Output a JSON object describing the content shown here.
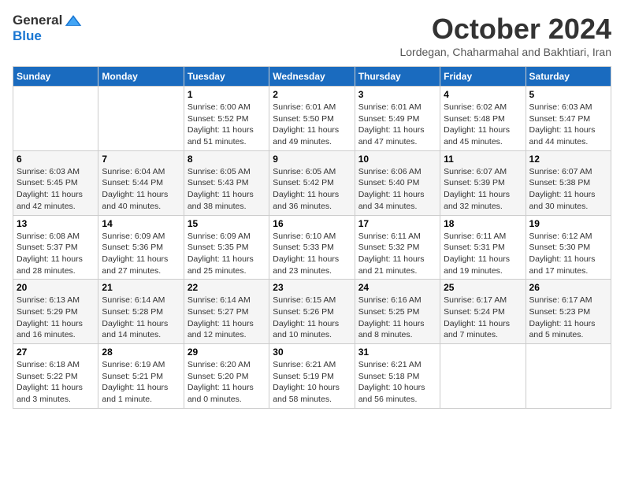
{
  "header": {
    "logo_general": "General",
    "logo_blue": "Blue",
    "month": "October 2024",
    "location": "Lordegan, Chaharmahal and Bakhtiari, Iran"
  },
  "weekdays": [
    "Sunday",
    "Monday",
    "Tuesday",
    "Wednesday",
    "Thursday",
    "Friday",
    "Saturday"
  ],
  "weeks": [
    [
      {
        "day": "",
        "info": ""
      },
      {
        "day": "",
        "info": ""
      },
      {
        "day": "1",
        "info": "Sunrise: 6:00 AM\nSunset: 5:52 PM\nDaylight: 11 hours and 51 minutes."
      },
      {
        "day": "2",
        "info": "Sunrise: 6:01 AM\nSunset: 5:50 PM\nDaylight: 11 hours and 49 minutes."
      },
      {
        "day": "3",
        "info": "Sunrise: 6:01 AM\nSunset: 5:49 PM\nDaylight: 11 hours and 47 minutes."
      },
      {
        "day": "4",
        "info": "Sunrise: 6:02 AM\nSunset: 5:48 PM\nDaylight: 11 hours and 45 minutes."
      },
      {
        "day": "5",
        "info": "Sunrise: 6:03 AM\nSunset: 5:47 PM\nDaylight: 11 hours and 44 minutes."
      }
    ],
    [
      {
        "day": "6",
        "info": "Sunrise: 6:03 AM\nSunset: 5:45 PM\nDaylight: 11 hours and 42 minutes."
      },
      {
        "day": "7",
        "info": "Sunrise: 6:04 AM\nSunset: 5:44 PM\nDaylight: 11 hours and 40 minutes."
      },
      {
        "day": "8",
        "info": "Sunrise: 6:05 AM\nSunset: 5:43 PM\nDaylight: 11 hours and 38 minutes."
      },
      {
        "day": "9",
        "info": "Sunrise: 6:05 AM\nSunset: 5:42 PM\nDaylight: 11 hours and 36 minutes."
      },
      {
        "day": "10",
        "info": "Sunrise: 6:06 AM\nSunset: 5:40 PM\nDaylight: 11 hours and 34 minutes."
      },
      {
        "day": "11",
        "info": "Sunrise: 6:07 AM\nSunset: 5:39 PM\nDaylight: 11 hours and 32 minutes."
      },
      {
        "day": "12",
        "info": "Sunrise: 6:07 AM\nSunset: 5:38 PM\nDaylight: 11 hours and 30 minutes."
      }
    ],
    [
      {
        "day": "13",
        "info": "Sunrise: 6:08 AM\nSunset: 5:37 PM\nDaylight: 11 hours and 28 minutes."
      },
      {
        "day": "14",
        "info": "Sunrise: 6:09 AM\nSunset: 5:36 PM\nDaylight: 11 hours and 27 minutes."
      },
      {
        "day": "15",
        "info": "Sunrise: 6:09 AM\nSunset: 5:35 PM\nDaylight: 11 hours and 25 minutes."
      },
      {
        "day": "16",
        "info": "Sunrise: 6:10 AM\nSunset: 5:33 PM\nDaylight: 11 hours and 23 minutes."
      },
      {
        "day": "17",
        "info": "Sunrise: 6:11 AM\nSunset: 5:32 PM\nDaylight: 11 hours and 21 minutes."
      },
      {
        "day": "18",
        "info": "Sunrise: 6:11 AM\nSunset: 5:31 PM\nDaylight: 11 hours and 19 minutes."
      },
      {
        "day": "19",
        "info": "Sunrise: 6:12 AM\nSunset: 5:30 PM\nDaylight: 11 hours and 17 minutes."
      }
    ],
    [
      {
        "day": "20",
        "info": "Sunrise: 6:13 AM\nSunset: 5:29 PM\nDaylight: 11 hours and 16 minutes."
      },
      {
        "day": "21",
        "info": "Sunrise: 6:14 AM\nSunset: 5:28 PM\nDaylight: 11 hours and 14 minutes."
      },
      {
        "day": "22",
        "info": "Sunrise: 6:14 AM\nSunset: 5:27 PM\nDaylight: 11 hours and 12 minutes."
      },
      {
        "day": "23",
        "info": "Sunrise: 6:15 AM\nSunset: 5:26 PM\nDaylight: 11 hours and 10 minutes."
      },
      {
        "day": "24",
        "info": "Sunrise: 6:16 AM\nSunset: 5:25 PM\nDaylight: 11 hours and 8 minutes."
      },
      {
        "day": "25",
        "info": "Sunrise: 6:17 AM\nSunset: 5:24 PM\nDaylight: 11 hours and 7 minutes."
      },
      {
        "day": "26",
        "info": "Sunrise: 6:17 AM\nSunset: 5:23 PM\nDaylight: 11 hours and 5 minutes."
      }
    ],
    [
      {
        "day": "27",
        "info": "Sunrise: 6:18 AM\nSunset: 5:22 PM\nDaylight: 11 hours and 3 minutes."
      },
      {
        "day": "28",
        "info": "Sunrise: 6:19 AM\nSunset: 5:21 PM\nDaylight: 11 hours and 1 minute."
      },
      {
        "day": "29",
        "info": "Sunrise: 6:20 AM\nSunset: 5:20 PM\nDaylight: 11 hours and 0 minutes."
      },
      {
        "day": "30",
        "info": "Sunrise: 6:21 AM\nSunset: 5:19 PM\nDaylight: 10 hours and 58 minutes."
      },
      {
        "day": "31",
        "info": "Sunrise: 6:21 AM\nSunset: 5:18 PM\nDaylight: 10 hours and 56 minutes."
      },
      {
        "day": "",
        "info": ""
      },
      {
        "day": "",
        "info": ""
      }
    ]
  ]
}
